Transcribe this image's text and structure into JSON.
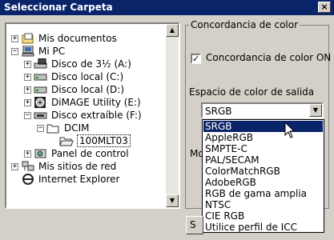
{
  "window": {
    "title": "Seleccionar Carpeta",
    "close_glyph": "×"
  },
  "tree": {
    "items": [
      {
        "label": "Mis documentos",
        "icon": "my-documents-icon",
        "expander": "+"
      },
      {
        "label": "Mi PC",
        "icon": "my-computer-icon",
        "expander": "−"
      },
      {
        "label": "Disco de 3½ (A:)",
        "icon": "floppy-drive-icon",
        "expander": "+"
      },
      {
        "label": "Disco local (C:)",
        "icon": "hard-drive-icon",
        "expander": "+"
      },
      {
        "label": "Disco local (D:)",
        "icon": "hard-drive-icon",
        "expander": "+"
      },
      {
        "label": "DiMAGE Utility (E:)",
        "icon": "cd-drive-icon",
        "expander": "+"
      },
      {
        "label": "Disco extraíble (F:)",
        "icon": "removable-drive-icon",
        "expander": "−"
      },
      {
        "label": "DCIM",
        "icon": "folder-open-icon",
        "expander": "−"
      },
      {
        "label": "100MLT03",
        "icon": "folder-open-icon",
        "expander": ""
      },
      {
        "label": "Panel de control",
        "icon": "control-panel-icon",
        "expander": "+"
      },
      {
        "label": "Mis sitios de red",
        "icon": "network-places-icon",
        "expander": "+"
      },
      {
        "label": "Internet Explorer",
        "icon": "internet-explorer-icon",
        "expander": ""
      }
    ]
  },
  "color_group": {
    "legend": "Concordancia de color",
    "checkbox_label": "Concordancia de color ON",
    "checkbox_checked": true,
    "checkbox_glyph": "✓",
    "space_label": "Espacio de color de salida",
    "combo_value": "SRGB",
    "partial_label": "Mo",
    "options": [
      "SRGB",
      "AppleRGB",
      "SMPTE-C",
      "PAL/SECAM",
      "ColorMatchRGB",
      "AdobeRGB",
      "RGB de gama amplia",
      "NTSC",
      "CIE RGB",
      "Utilice perfil de ICC"
    ],
    "selected_option": "SRGB"
  },
  "bottom": {
    "button_partial": "S"
  },
  "colors": {
    "titlebar": "#0a246a",
    "selection": "#0a246a",
    "face": "#d4d0c8"
  }
}
